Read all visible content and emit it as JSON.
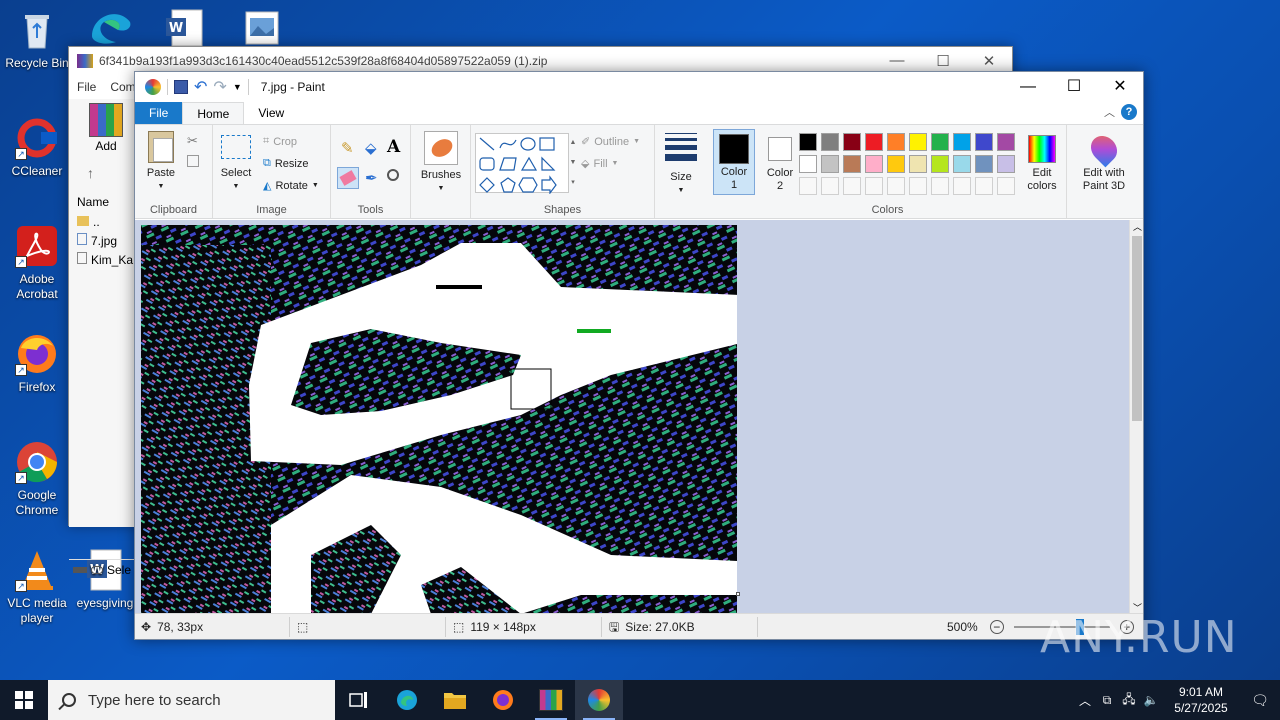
{
  "desktop": {
    "icons": [
      {
        "label": "Recycle Bin"
      },
      {
        "label": "CCleaner"
      },
      {
        "label": "Adobe Acrobat"
      },
      {
        "label": "Firefox"
      },
      {
        "label": "Google Chrome"
      },
      {
        "label": "VLC media player"
      },
      {
        "label": "eyesgiving"
      }
    ]
  },
  "winrar": {
    "title": "6f341b9a193f1a993d3c161430c40ead5512c539f28a8f68404d05897522a059 (1).zip",
    "menu": [
      "File",
      "Com"
    ],
    "add_label": "Add",
    "column_name": "Name",
    "files": [
      "..",
      "7.jpg",
      "Kim_Ka"
    ],
    "status_sel": "Sele"
  },
  "paint": {
    "title": "7.jpg - Paint",
    "tabs": {
      "file": "File",
      "home": "Home",
      "view": "View"
    },
    "clipboard": {
      "paste": "Paste",
      "group": "Clipboard"
    },
    "image": {
      "select": "Select",
      "crop": "Crop",
      "resize": "Resize",
      "rotate": "Rotate",
      "group": "Image"
    },
    "tools": {
      "group": "Tools"
    },
    "brushes": {
      "label": "Brushes"
    },
    "shapes": {
      "outline": "Outline",
      "fill": "Fill",
      "group": "Shapes"
    },
    "size": {
      "label": "Size"
    },
    "color1": {
      "label": "Color 1"
    },
    "color2": {
      "label": "Color 2"
    },
    "colors": {
      "group": "Colors",
      "row1": [
        "#000000",
        "#7f7f7f",
        "#880015",
        "#ed1c24",
        "#ff7f27",
        "#fff200",
        "#22b14c",
        "#00a2e8",
        "#3f48cc",
        "#a349a4"
      ],
      "row2": [
        "#ffffff",
        "#c3c3c3",
        "#b97a57",
        "#ffaec9",
        "#ffc90e",
        "#efe4b0",
        "#b5e61d",
        "#99d9ea",
        "#7092be",
        "#c8bfe7"
      ]
    },
    "edit_colors": "Edit colors",
    "edit_paint3d": "Edit with Paint 3D",
    "status": {
      "cursor": "78, 33px",
      "selection": "119 × 148px",
      "size": "Size: 27.0KB",
      "zoom": "500%"
    }
  },
  "taskbar": {
    "search_placeholder": "Type here to search",
    "time": "9:01 AM",
    "date": "5/27/2025"
  },
  "watermark": "ANY.RUN"
}
